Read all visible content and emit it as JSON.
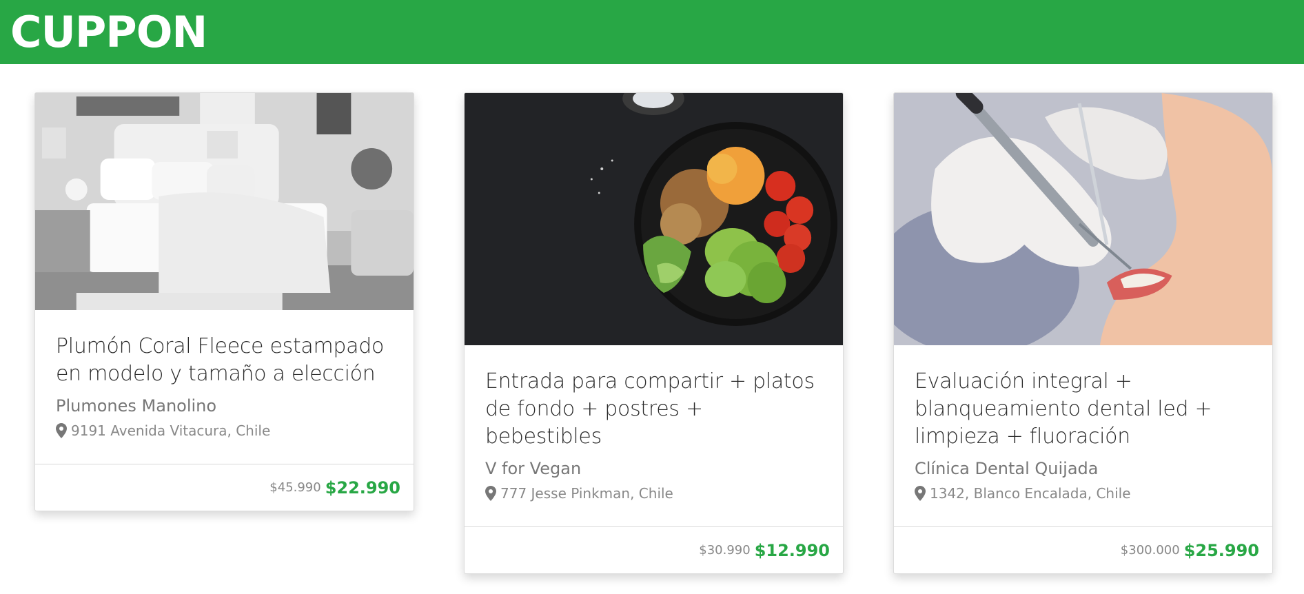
{
  "header": {
    "brand": "CUPPON"
  },
  "colors": {
    "brand": "#28a745",
    "price": "#28a745"
  },
  "deals": [
    {
      "title": "Plumón Coral Fleece estampado en modelo y tamaño a elección",
      "merchant": "Plumones Manolino",
      "address": "9191 Avenida Vitacura, Chile",
      "old_price": "$45.990",
      "new_price": "$22.990",
      "image": "bedroom-photo"
    },
    {
      "title": "Entrada para compartir + platos de fondo + postres + bebestibles",
      "merchant": "V for Vegan",
      "address": "777 Jesse Pinkman, Chile",
      "old_price": "$30.990",
      "new_price": "$12.990",
      "image": "vegan-bowl-photo"
    },
    {
      "title": "Evaluación integral + blanqueamiento dental led + limpieza + fluoración",
      "merchant": "Clínica Dental Quijada",
      "address": "1342, Blanco Encalada, Chile",
      "old_price": "$300.000",
      "new_price": "$25.990",
      "image": "dental-photo"
    }
  ],
  "icons": {
    "address": "map-marker-icon"
  }
}
